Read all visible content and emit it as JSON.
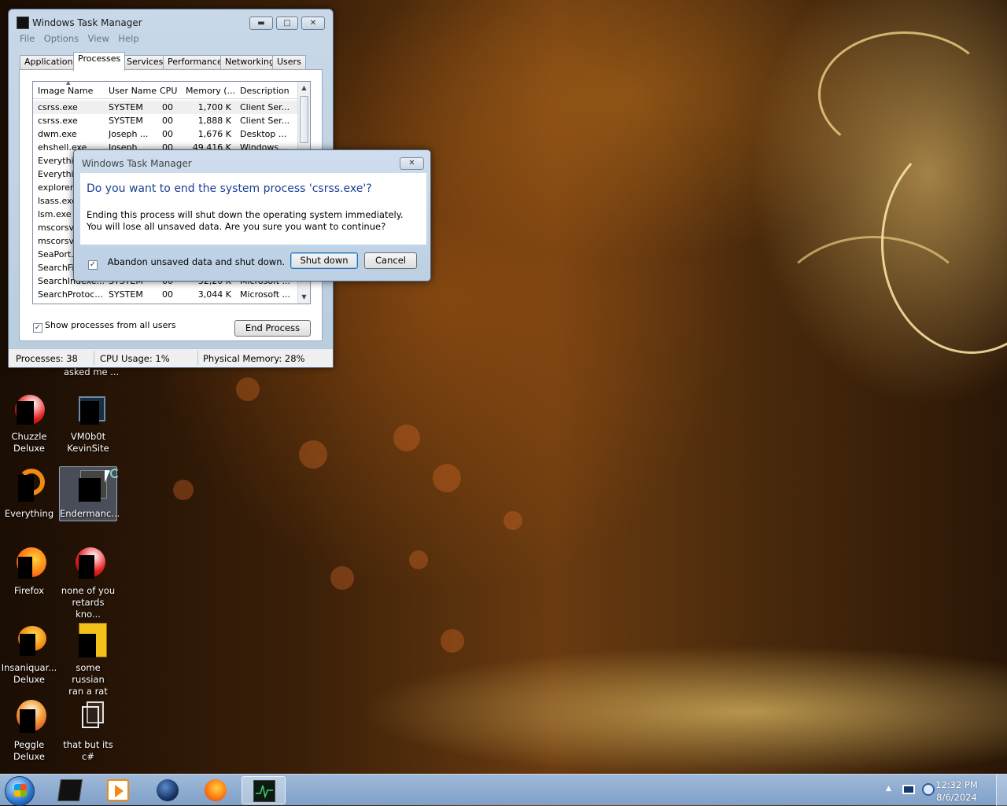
{
  "task_manager": {
    "title": "Windows Task Manager",
    "menu": [
      "File",
      "Options",
      "View",
      "Help"
    ],
    "tabs": [
      "Applications",
      "Processes",
      "Services",
      "Performance",
      "Networking",
      "Users"
    ],
    "active_tab": "Processes",
    "columns": [
      "Image Name",
      "User Name",
      "CPU",
      "Memory (...",
      "Description"
    ],
    "processes": [
      {
        "image": "csrss.exe",
        "user": "SYSTEM",
        "cpu": "00",
        "mem": "1,700 K",
        "desc": "Client Ser..."
      },
      {
        "image": "csrss.exe",
        "user": "SYSTEM",
        "cpu": "00",
        "mem": "1,888 K",
        "desc": "Client Ser..."
      },
      {
        "image": "dwm.exe",
        "user": "Joseph ...",
        "cpu": "00",
        "mem": "1,676 K",
        "desc": "Desktop ..."
      },
      {
        "image": "ehshell.exe",
        "user": "Joseph",
        "cpu": "00",
        "mem": "49,416 K",
        "desc": "Windows..."
      },
      {
        "image": "Everythi",
        "user": "",
        "cpu": "",
        "mem": "",
        "desc": ""
      },
      {
        "image": "Everythi",
        "user": "",
        "cpu": "",
        "mem": "",
        "desc": ""
      },
      {
        "image": "explorer.",
        "user": "",
        "cpu": "",
        "mem": "",
        "desc": ""
      },
      {
        "image": "lsass.exe",
        "user": "",
        "cpu": "",
        "mem": "",
        "desc": ""
      },
      {
        "image": "lsm.exe",
        "user": "",
        "cpu": "",
        "mem": "",
        "desc": ""
      },
      {
        "image": "mscorsv",
        "user": "",
        "cpu": "",
        "mem": "",
        "desc": ""
      },
      {
        "image": "mscorsv",
        "user": "",
        "cpu": "",
        "mem": "",
        "desc": ""
      },
      {
        "image": "SeaPort.",
        "user": "",
        "cpu": "",
        "mem": "",
        "desc": ""
      },
      {
        "image": "SearchFil",
        "user": "",
        "cpu": "",
        "mem": "",
        "desc": ""
      },
      {
        "image": "SearchIndexe...",
        "user": "SYSTEM",
        "cpu": "00",
        "mem": "32,20 K",
        "desc": "Microsoft ..."
      },
      {
        "image": "SearchProtoc...",
        "user": "SYSTEM",
        "cpu": "00",
        "mem": "3,044 K",
        "desc": "Microsoft ..."
      }
    ],
    "show_all_label": "Show processes from all users",
    "show_all_checked": true,
    "end_process_label": "End Process",
    "status": {
      "processes": "Processes: 38",
      "cpu": "CPU Usage: 1%",
      "memory": "Physical Memory: 28%"
    }
  },
  "dialog": {
    "title": "Windows Task Manager",
    "heading": "Do you want to end the system process 'csrss.exe'?",
    "body": "Ending this process will shut down the operating system immediately.  You will lose all unsaved data.  Are you sure you want to continue?",
    "checkbox_label": "Abandon unsaved data and shut down.",
    "checkbox_checked": true,
    "shutdown_label": "Shut down",
    "cancel_label": "Cancel"
  },
  "desktop": {
    "partial_label": "asked me ...",
    "icons": [
      {
        "id": "chuzzle",
        "label1": "Chuzzle",
        "label2": "Deluxe",
        "icon": "chuzzle-icon"
      },
      {
        "id": "vm",
        "label1": "VM0b0t",
        "label2": "KevinSite",
        "icon": "vm-window-icon"
      },
      {
        "id": "everything",
        "label1": "Everything",
        "label2": "",
        "icon": "everything-search-icon"
      },
      {
        "id": "endermanch",
        "label1": "Endermanc...",
        "label2": "",
        "icon": "shortcut-icon",
        "selected": true
      },
      {
        "id": "firefox",
        "label1": "Firefox",
        "label2": "",
        "icon": "firefox-icon"
      },
      {
        "id": "noneofyou",
        "label1": "none of you",
        "label2": "retards kno...",
        "icon": "chuzzle-icon"
      },
      {
        "id": "insaniquarium",
        "label1": "Insaniquar...",
        "label2": "Deluxe",
        "icon": "fish-icon"
      },
      {
        "id": "russian",
        "label1": "some russian",
        "label2": "ran a rat",
        "icon": "text-file-icon"
      },
      {
        "id": "peggle",
        "label1": "Peggle",
        "label2": "Deluxe",
        "icon": "peggle-icon"
      },
      {
        "id": "thatbutits",
        "label1": "that but its",
        "label2": "c#",
        "icon": "copy-icon"
      }
    ]
  },
  "taskbar": {
    "pinned": [
      "terminal-icon",
      "media-player-icon",
      "globe-icon",
      "firefox-icon",
      "task-manager-icon"
    ],
    "active": "task-manager-icon",
    "time": "12:32 PM",
    "date": "8/6/2024"
  },
  "colors": {
    "dialog_heading": "#1c3f94",
    "taskbar": "#8aa9cf"
  }
}
